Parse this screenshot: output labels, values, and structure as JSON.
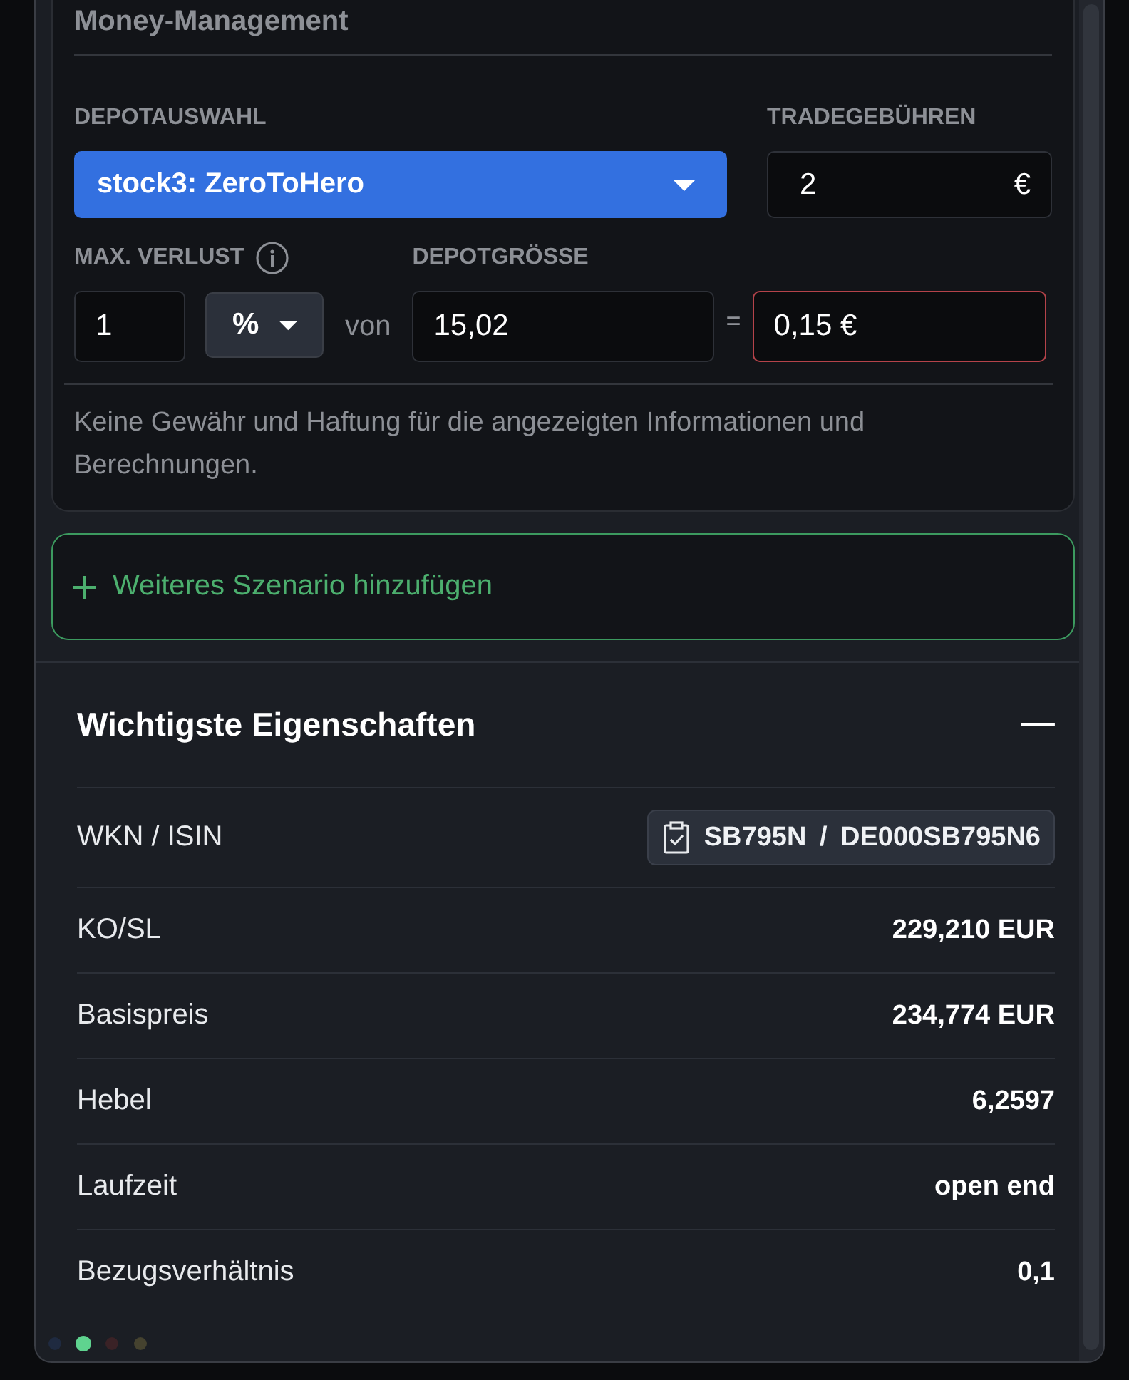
{
  "money_management": {
    "title": "Money-Management",
    "depot_select": {
      "label": "DEPOTAUSWAHL",
      "value": "stock3: ZeroToHero"
    },
    "trade_fees": {
      "label": "TRADEGEBÜHREN",
      "value": "2",
      "unit": "€"
    },
    "max_loss": {
      "label": "MAX. VERLUST",
      "value": "1",
      "unit_select": "%"
    },
    "connector": "von",
    "depot_size": {
      "label": "DEPOTGRÖSSE",
      "value": "15,02"
    },
    "equals": "=",
    "result": {
      "value": "0,15 €"
    },
    "disclaimer": "Keine Gewähr und Haftung für die angezeigten Informationen und Berechnungen."
  },
  "add_scenario": {
    "label": "Weiteres Szenario hinzufügen"
  },
  "properties": {
    "title": "Wichtigste Eigenschaften",
    "expanded": true,
    "rows": [
      {
        "kind": "identifier",
        "label": "WKN / ISIN",
        "value": "SB795N / DE000SB795N6"
      },
      {
        "kind": "value",
        "label": "KO/SL",
        "value": "229,210 EUR"
      },
      {
        "kind": "value",
        "label": "Basispreis",
        "value": "234,774 EUR"
      },
      {
        "kind": "value",
        "label": "Hebel",
        "value": "6,2597"
      },
      {
        "kind": "value",
        "label": "Laufzeit",
        "value": "open end"
      },
      {
        "kind": "value",
        "label": "Bezugsverhältnis",
        "value": "0,1"
      }
    ]
  },
  "page_dots": [
    {
      "color": "#1f2a40",
      "selected": false
    },
    {
      "color": "#5fd38f",
      "selected": true
    },
    {
      "color": "#3a2226",
      "selected": false
    },
    {
      "color": "#45422f",
      "selected": false
    }
  ]
}
